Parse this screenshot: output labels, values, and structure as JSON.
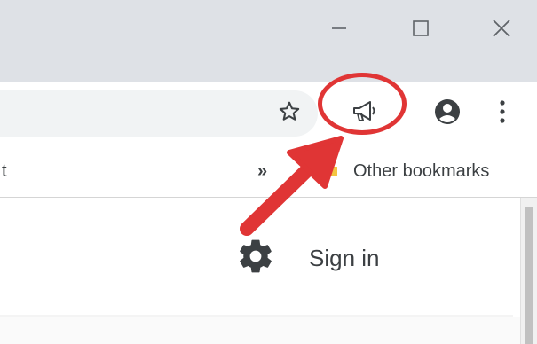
{
  "window": {
    "minimize_icon": "minimize-icon",
    "maximize_icon": "maximize-icon",
    "close_icon": "close-icon"
  },
  "toolbar": {
    "bookmark_star_icon": "star-icon",
    "announcement_icon": "megaphone-icon",
    "profile_icon": "account-circle-icon",
    "menu_icon": "vertical-dots-icon"
  },
  "bookmarks_bar": {
    "left_truncated_text": "t",
    "overflow_chevron": "»",
    "other_bookmarks_label": "Other bookmarks"
  },
  "content": {
    "settings_icon": "gear-icon",
    "sign_in_label": "Sign in"
  },
  "colors": {
    "titlebar": "#dee1e6",
    "omnibox": "#f1f3f4",
    "annotation_red": "#e03535",
    "icon_gray": "#5f6368"
  }
}
